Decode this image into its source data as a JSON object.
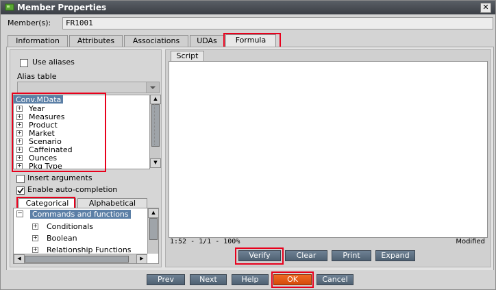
{
  "window": {
    "title": "Member Properties",
    "close_glyph": "✕"
  },
  "member": {
    "label": "Member(s):",
    "value": "FR1001"
  },
  "tabs": [
    {
      "label": "Information"
    },
    {
      "label": "Attributes"
    },
    {
      "label": "Associations"
    },
    {
      "label": "UDAs"
    },
    {
      "label": "Formula"
    }
  ],
  "active_tab": "Formula",
  "left": {
    "use_aliases_label": "Use aliases",
    "use_aliases_checked": false,
    "alias_table_label": "Alias table",
    "alias_table_value": "",
    "tree_root": "Conv.MData",
    "tree_items": [
      {
        "label": "Year"
      },
      {
        "label": "Measures"
      },
      {
        "label": "Product"
      },
      {
        "label": "Market"
      },
      {
        "label": "Scenario"
      },
      {
        "label": "Caffeinated"
      },
      {
        "label": "Ounces"
      },
      {
        "label": "Pkg Type"
      }
    ],
    "insert_arguments_label": "Insert arguments",
    "insert_arguments_checked": false,
    "auto_completion_label": "Enable auto-completion",
    "auto_completion_checked": true,
    "category_tabs": [
      {
        "label": "Categorical"
      },
      {
        "label": "Alphabetical"
      }
    ],
    "function_root": "Commands and functions",
    "function_items": [
      {
        "label": "Conditionals"
      },
      {
        "label": "Boolean"
      },
      {
        "label": "Relationship Functions"
      }
    ]
  },
  "right": {
    "script_tab_label": "Script",
    "script_content": "",
    "position_status": "1:52 - 1/1 - 100%",
    "modified_status": "Modified",
    "buttons": [
      {
        "label": "Verify"
      },
      {
        "label": "Clear"
      },
      {
        "label": "Print"
      },
      {
        "label": "Expand"
      }
    ]
  },
  "footer_buttons": [
    {
      "label": "Prev"
    },
    {
      "label": "Next"
    },
    {
      "label": "Help"
    },
    {
      "label": "OK"
    },
    {
      "label": "Cancel"
    }
  ],
  "colors": {
    "highlight_red": "#e8001c",
    "selection_blue": "#5b7fa6",
    "button_blue": "#5a6d80",
    "ok_orange": "#e35a14"
  }
}
